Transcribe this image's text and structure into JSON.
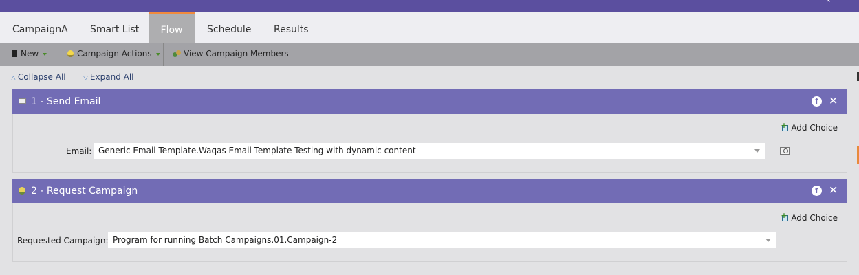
{
  "tabs": [
    "CampaignA",
    "Smart List",
    "Flow",
    "Schedule",
    "Results"
  ],
  "active_tab": "Flow",
  "toolbar": {
    "new_label": "New",
    "campaign_actions_label": "Campaign Actions",
    "view_members_label": "View Campaign Members"
  },
  "controls": {
    "collapse_all": "Collapse All",
    "expand_all": "Expand All"
  },
  "steps": [
    {
      "title": "1 - Send Email",
      "icon": "email-icon",
      "add_choice": "Add Choice",
      "field_label": "Email:",
      "field_value": "Generic Email Template.Waqas Email Template Testing with dynamic content"
    },
    {
      "title": "2 - Request Campaign",
      "icon": "bulb-icon",
      "add_choice": "Add Choice",
      "field_label": "Requested Campaign:",
      "field_value": "Program for running Batch Campaigns.01.Campaign-2"
    }
  ],
  "colors": {
    "header_bar": "#5b4f9f",
    "step_header": "#726cb5",
    "active_tab_accent": "#f08a3c",
    "toolbar": "#a3a3a7"
  }
}
